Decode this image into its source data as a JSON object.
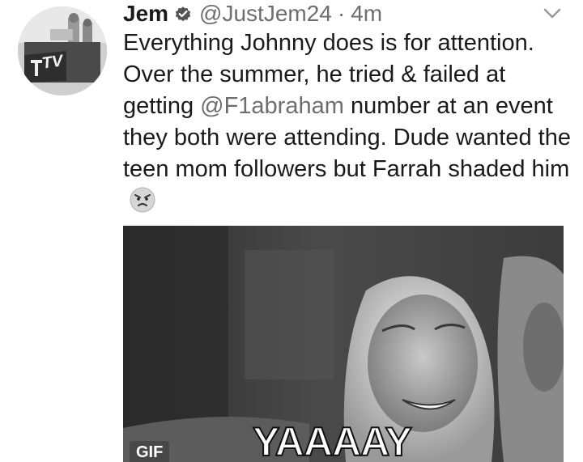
{
  "tweet": {
    "display_name": "Jem",
    "handle": "@JustJem24",
    "separator": "·",
    "time": "4m",
    "text_part1": "Everything Johnny does is for attention. Over the summer, he tried & failed at getting ",
    "mention": "@F1abraham",
    "text_part2": " number at an event they both were attending. Dude wanted the teen mom followers but Farrah shaded him"
  },
  "avatar": {
    "logo_text": "TV"
  },
  "media": {
    "caption": "YAAAAY",
    "badge": "GIF"
  },
  "icons": {
    "verified": "verified-badge-icon",
    "menu": "chevron-down-icon",
    "emoji": "angry-face-emoji-icon"
  },
  "colors": {
    "text": "#1a1a1a",
    "secondary": "#6e6e6e"
  }
}
